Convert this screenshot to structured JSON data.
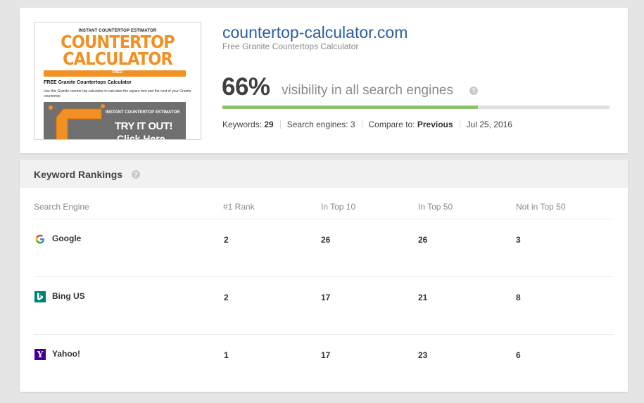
{
  "site": {
    "domain": "countertop-calculator.com",
    "subtitle": "Free Granite Countertops Calculator",
    "thumbnail": {
      "supertitle": "INSTANT COUNTERTOP ESTIMATOR",
      "title_line1": "COUNTERTOP",
      "title_line2": "CALCULATOR",
      "free_tag": "FREE!",
      "heading": "FREE Granite Countertops Calculator",
      "description": "Use this Granite counter top calculator to calculate the square foot and the cost of your Granite countertop",
      "ad_supertitle": "INSTANT COUNTERTOP ESTIMATOR",
      "ad_cta": "TRY IT OUT!",
      "ad_click": "Click Here"
    }
  },
  "visibility": {
    "percent_label": "66%",
    "percent_value": 66,
    "text": "visibility in all search engines",
    "help_icon": "question-circle-icon",
    "bar_color": "#8bc26d"
  },
  "stats": {
    "keywords_label": "Keywords:",
    "keywords_value": "29",
    "engines_label": "Search engines:",
    "engines_value": "3",
    "compare_label": "Compare to:",
    "compare_value": "Previous",
    "date": "Jul 25, 2016"
  },
  "rankings": {
    "title": "Keyword Rankings",
    "columns": [
      "Search Engine",
      "#1 Rank",
      "In Top 10",
      "In Top 50",
      "Not in Top 50"
    ],
    "rows": [
      {
        "engine": "Google",
        "icon": "google-icon",
        "rank1": "2",
        "top10": "26",
        "top50": "26",
        "not50": "3"
      },
      {
        "engine": "Bing US",
        "icon": "bing-icon",
        "rank1": "2",
        "top10": "17",
        "top50": "21",
        "not50": "8"
      },
      {
        "engine": "Yahoo!",
        "icon": "yahoo-icon",
        "rank1": "1",
        "top10": "17",
        "top50": "23",
        "not50": "6"
      }
    ]
  },
  "colors": {
    "link_blue": "#2b5e9e",
    "accent_orange": "#f39024",
    "bing_teal": "#008373",
    "yahoo_purple": "#410093"
  }
}
